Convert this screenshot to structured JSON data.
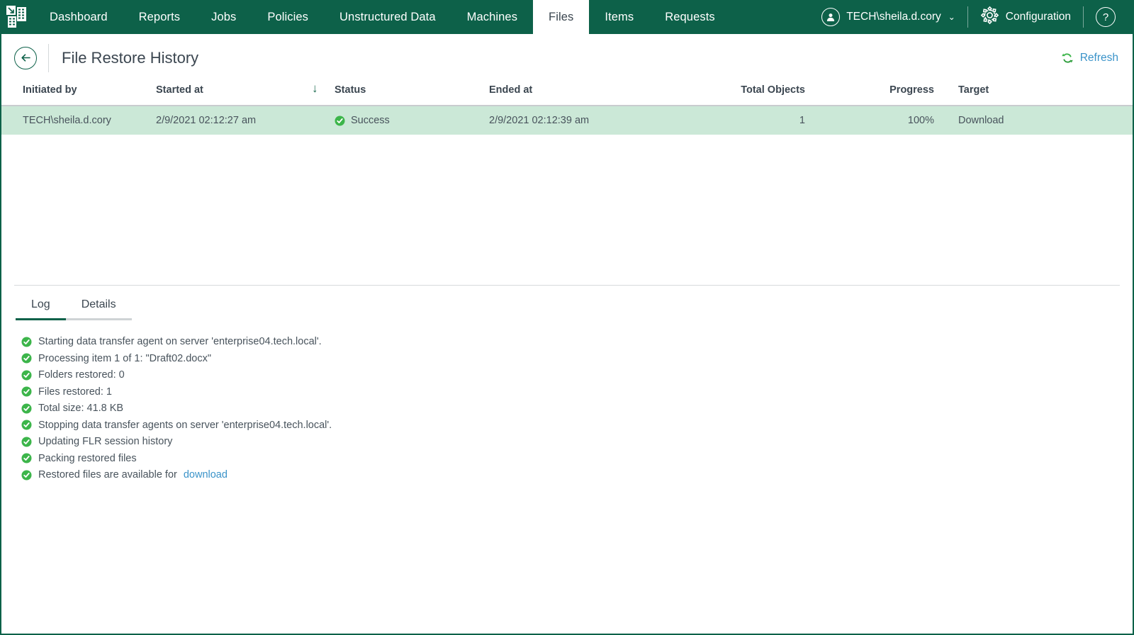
{
  "colors": {
    "brand_green": "#0d6149",
    "row_selected_bg": "#cbe8d7",
    "link_blue": "#3a93c9",
    "success_green": "#3cb54a",
    "text_dark": "#3b4650"
  },
  "topbar": {
    "logo_icon": "veeam-building-download-icon",
    "tabs": [
      {
        "label": "Dashboard",
        "active": false
      },
      {
        "label": "Reports",
        "active": false
      },
      {
        "label": "Jobs",
        "active": false
      },
      {
        "label": "Policies",
        "active": false
      },
      {
        "label": "Unstructured Data",
        "active": false
      },
      {
        "label": "Machines",
        "active": false
      },
      {
        "label": "Files",
        "active": true
      },
      {
        "label": "Items",
        "active": false
      },
      {
        "label": "Requests",
        "active": false
      }
    ],
    "user": {
      "icon": "user-avatar-icon",
      "label": "TECH\\sheila.d.cory",
      "caret": "⌄"
    },
    "configuration": {
      "icon": "gear-icon",
      "label": "Configuration"
    },
    "help": {
      "icon": "help-icon",
      "glyph": "?"
    }
  },
  "header": {
    "back_icon": "back-arrow-icon",
    "title": "File Restore History",
    "refresh": {
      "icon": "refresh-icon",
      "label": "Refresh"
    }
  },
  "table": {
    "columns": [
      "Initiated by",
      "Started at",
      "Status",
      "Ended at",
      "Total Objects",
      "Progress",
      "Target"
    ],
    "sort": {
      "column": "Started at",
      "direction": "descending",
      "glyph": "↓"
    },
    "rows": [
      {
        "initiated_by": "TECH\\sheila.d.cory",
        "started_at": "2/9/2021 02:12:27 am",
        "status": "Success",
        "status_icon": "success-check-icon",
        "ended_at": "2/9/2021 02:12:39 am",
        "total_objects": "1",
        "progress": "100%",
        "target": "Download",
        "selected": true
      }
    ]
  },
  "details_panel": {
    "tabs": [
      {
        "label": "Log",
        "active": true
      },
      {
        "label": "Details",
        "active": false
      }
    ],
    "log_entries": [
      {
        "icon": "success-check-icon",
        "text": "Starting data transfer agent on server 'enterprise04.tech.local'."
      },
      {
        "icon": "success-check-icon",
        "text": "Processing item 1 of 1: \"Draft02.docx\""
      },
      {
        "icon": "success-check-icon",
        "text": "Folders restored: 0"
      },
      {
        "icon": "success-check-icon",
        "text": "Files restored: 1"
      },
      {
        "icon": "success-check-icon",
        "text": "Total size: 41.8 KB"
      },
      {
        "icon": "success-check-icon",
        "text": "Stopping data transfer agents on server 'enterprise04.tech.local'."
      },
      {
        "icon": "success-check-icon",
        "text": "Updating FLR session history"
      },
      {
        "icon": "success-check-icon",
        "text": "Packing restored files"
      },
      {
        "icon": "success-check-icon",
        "text": "Restored files are available for ",
        "link_text": "download"
      }
    ]
  }
}
